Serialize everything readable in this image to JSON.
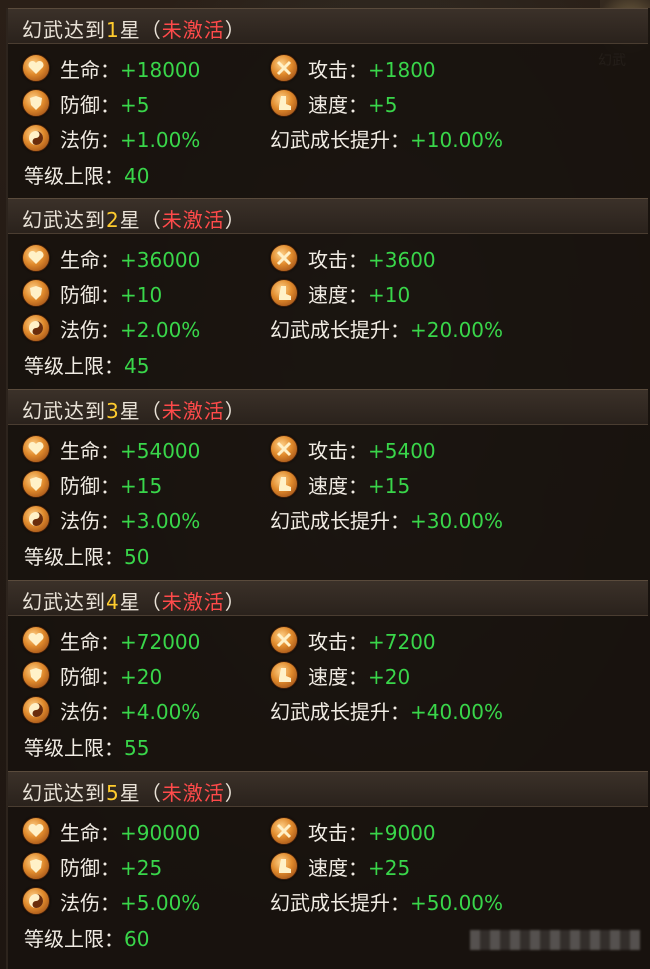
{
  "corner_label": "幻武",
  "sections": [
    {
      "prefix": "幻武达到",
      "star": "1",
      "suffix": "星",
      "paren_open": "（",
      "status": "未激活",
      "paren_close": "）",
      "hp": {
        "label": "生命：",
        "value": "+18000"
      },
      "atk": {
        "label": "攻击：",
        "value": "+1800"
      },
      "def": {
        "label": "防御：",
        "value": "+5"
      },
      "spd": {
        "label": "速度：",
        "value": "+5"
      },
      "mag": {
        "label": "法伤：",
        "value": "+1.00%"
      },
      "growth": {
        "label": "幻武成长提升：",
        "value": "+10.00%"
      },
      "cap": {
        "label": "等级上限：",
        "value": "40"
      }
    },
    {
      "prefix": "幻武达到",
      "star": "2",
      "suffix": "星",
      "paren_open": "（",
      "status": "未激活",
      "paren_close": "）",
      "hp": {
        "label": "生命：",
        "value": "+36000"
      },
      "atk": {
        "label": "攻击：",
        "value": "+3600"
      },
      "def": {
        "label": "防御：",
        "value": "+10"
      },
      "spd": {
        "label": "速度：",
        "value": "+10"
      },
      "mag": {
        "label": "法伤：",
        "value": "+2.00%"
      },
      "growth": {
        "label": "幻武成长提升：",
        "value": "+20.00%"
      },
      "cap": {
        "label": "等级上限：",
        "value": "45"
      }
    },
    {
      "prefix": "幻武达到",
      "star": "3",
      "suffix": "星",
      "paren_open": "（",
      "status": "未激活",
      "paren_close": "）",
      "hp": {
        "label": "生命：",
        "value": "+54000"
      },
      "atk": {
        "label": "攻击：",
        "value": "+5400"
      },
      "def": {
        "label": "防御：",
        "value": "+15"
      },
      "spd": {
        "label": "速度：",
        "value": "+15"
      },
      "mag": {
        "label": "法伤：",
        "value": "+3.00%"
      },
      "growth": {
        "label": "幻武成长提升：",
        "value": "+30.00%"
      },
      "cap": {
        "label": "等级上限：",
        "value": "50"
      }
    },
    {
      "prefix": "幻武达到",
      "star": "4",
      "suffix": "星",
      "paren_open": "（",
      "status": "未激活",
      "paren_close": "）",
      "hp": {
        "label": "生命：",
        "value": "+72000"
      },
      "atk": {
        "label": "攻击：",
        "value": "+7200"
      },
      "def": {
        "label": "防御：",
        "value": "+20"
      },
      "spd": {
        "label": "速度：",
        "value": "+20"
      },
      "mag": {
        "label": "法伤：",
        "value": "+4.00%"
      },
      "growth": {
        "label": "幻武成长提升：",
        "value": "+40.00%"
      },
      "cap": {
        "label": "等级上限：",
        "value": "55"
      }
    },
    {
      "prefix": "幻武达到",
      "star": "5",
      "suffix": "星",
      "paren_open": "（",
      "status": "未激活",
      "paren_close": "）",
      "hp": {
        "label": "生命：",
        "value": "+90000"
      },
      "atk": {
        "label": "攻击：",
        "value": "+9000"
      },
      "def": {
        "label": "防御：",
        "value": "+25"
      },
      "spd": {
        "label": "速度：",
        "value": "+25"
      },
      "mag": {
        "label": "法伤：",
        "value": "+5.00%"
      },
      "growth": {
        "label": "幻武成长提升：",
        "value": "+50.00%"
      },
      "cap": {
        "label": "等级上限：",
        "value": "60"
      }
    }
  ]
}
